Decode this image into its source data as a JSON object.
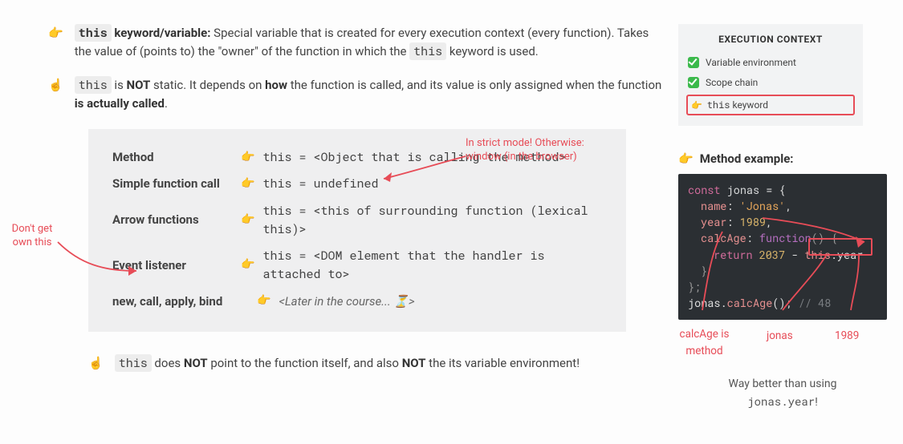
{
  "points": {
    "p1_emoji": "👉",
    "p1_pre": " keyword/variable:",
    "p1_text": " Special variable that is created for every execution context (every function). Takes the value of (points to) the \"owner\" of the function in which the ",
    "p1_tail": " keyword is used.",
    "this_kw": "this",
    "p2_emoji": "☝️",
    "p2_a": " is ",
    "p2_not": "NOT",
    "p2_b": " static. It depends on ",
    "p2_how": "how",
    "p2_c": " the function is called, and its value is only assigned when the function ",
    "p2_d": "is actually called",
    "p2_e": ".",
    "p3_emoji": "☝️",
    "p3_a": " does ",
    "p3_b": " point to the function itself, and also ",
    "p3_c": " the its variable environment!"
  },
  "table": {
    "ptr_emoji": "👉",
    "rows": {
      "method": {
        "label": "Method",
        "val": "this = <Object that is calling the method>"
      },
      "simple": {
        "label": "Simple function call",
        "val": "this = undefined"
      },
      "arrow": {
        "label": "Arrow functions",
        "val": "this = <this of surrounding function (lexical this)>"
      },
      "event": {
        "label": "Event listener",
        "val": "this = <DOM element that the handler is attached to>"
      },
      "later": {
        "label": "new, call, apply, bind",
        "val": "<Later in the course... ⏳>"
      }
    }
  },
  "annotations": {
    "dont_get": "Don't get own this",
    "strict": "In strict mode! Otherwise: window (in the browser)"
  },
  "sidebar": {
    "title": "EXECUTION CONTEXT",
    "items": {
      "var_env": "Variable environment",
      "scope": "Scope chain",
      "this_kw_pre": "this",
      "this_kw_post": " keyword"
    },
    "ptr_emoji": "👉"
  },
  "example": {
    "title_emoji": "👉",
    "title": "Method example:",
    "line1_kw": "const",
    "line1_name": " jonas ",
    "line1_rest": "= {",
    "line2_prop": "name",
    "line2_sep": ": ",
    "line2_str": "'Jonas'",
    "line2_end": ",",
    "line3_prop": "year",
    "line3_sep": ": ",
    "line3_num": "1989",
    "line3_end": ",",
    "line4_prop": "calcAge",
    "line4_sep": ": ",
    "line4_fn": "function",
    "line4_rest": "() {",
    "line5_kw": "return",
    "line5_num": " 2037 ",
    "line5_op": "- ",
    "line5_this": "this",
    "line5_dot": ".year",
    "line6": "}",
    "line7": "};",
    "line8_a": "jonas.",
    "line8_b": "calcAge",
    "line8_c": "();",
    "line8_comment": " // 48",
    "labels": {
      "calcage": "calcAge is method",
      "jonas": "jonas",
      "year": "1989"
    },
    "closing_a": "Way better than using",
    "closing_b": "jonas.year",
    "closing_c": "!"
  }
}
